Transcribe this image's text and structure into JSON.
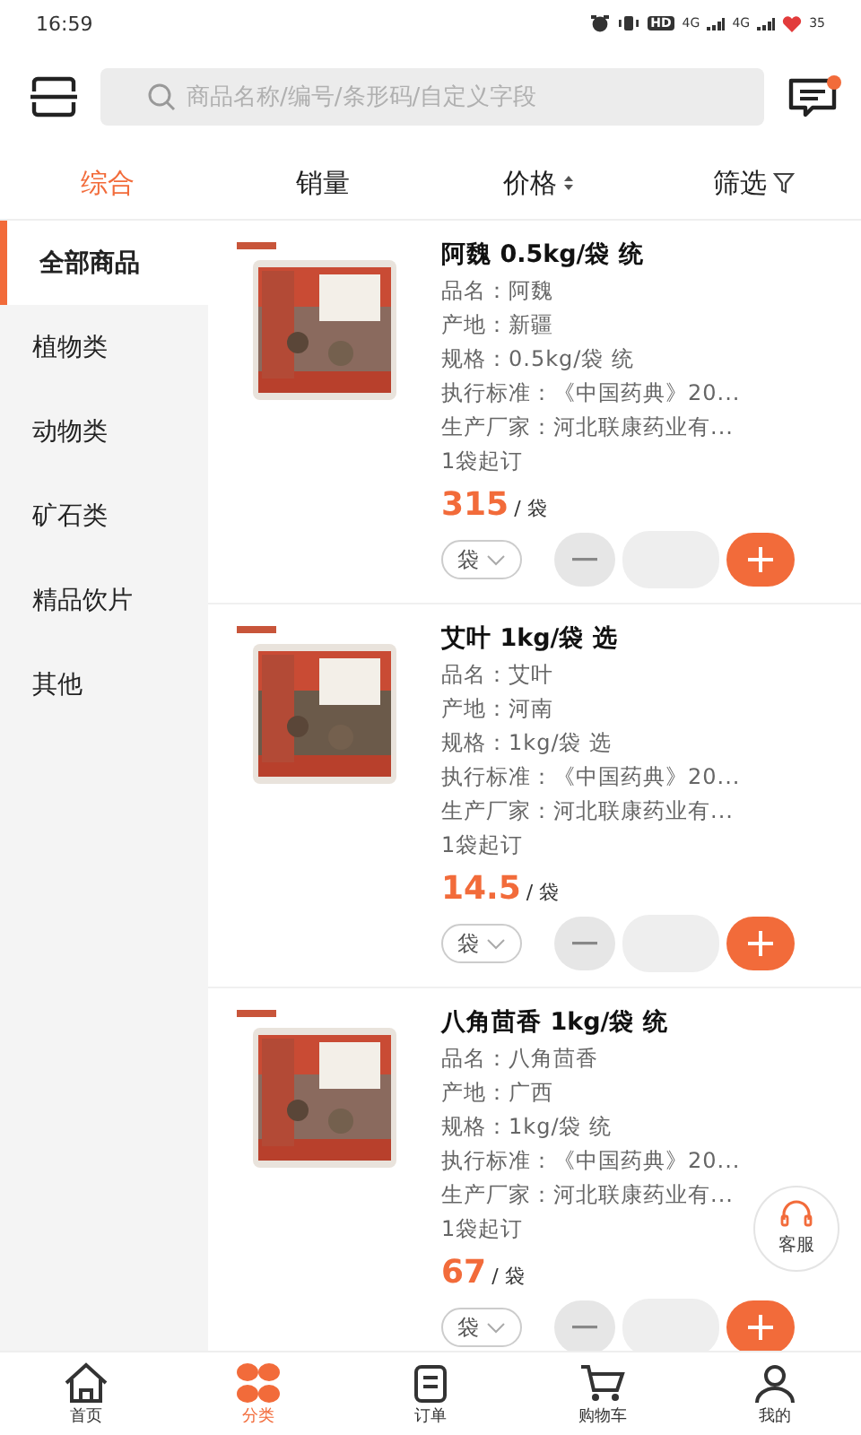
{
  "status_bar": {
    "time": "16:59",
    "hd": "HD",
    "networks": [
      "4G",
      "4G"
    ],
    "battery": "35"
  },
  "header": {
    "search": {
      "placeholder": "商品名称/编号/条形码/自定义字段"
    },
    "message_unread": true
  },
  "sort_tabs": [
    {
      "label": "综合",
      "selected": true,
      "kind": "plain"
    },
    {
      "label": "销量",
      "selected": false,
      "kind": "plain"
    },
    {
      "label": "价格",
      "selected": false,
      "kind": "sort"
    },
    {
      "label": "筛选",
      "selected": false,
      "kind": "filter"
    }
  ],
  "sidebar": {
    "items": [
      {
        "label": "全部商品",
        "selected": true
      },
      {
        "label": "植物类",
        "selected": false
      },
      {
        "label": "动物类",
        "selected": false
      },
      {
        "label": "矿石类",
        "selected": false
      },
      {
        "label": "精品饮片",
        "selected": false
      },
      {
        "label": "其他",
        "selected": false
      }
    ]
  },
  "products": [
    {
      "title": "阿魏 0.5kg/袋 统",
      "details": [
        "品名：阿魏",
        "产地：新疆",
        "规格：0.5kg/袋 统",
        "执行标准：《中国药典》20...",
        "生产厂家：河北联康药业有..."
      ],
      "min_order": "1袋起订",
      "price": "315",
      "price_unit": "/ 袋",
      "unit_select": "袋"
    },
    {
      "title": "艾叶 1kg/袋 选",
      "details": [
        "品名：艾叶",
        "产地：河南",
        "规格：1kg/袋 选",
        "执行标准：《中国药典》20...",
        "生产厂家：河北联康药业有..."
      ],
      "min_order": "1袋起订",
      "price": "14.5",
      "price_unit": "/ 袋",
      "unit_select": "袋"
    },
    {
      "title": "八角茴香 1kg/袋 统",
      "details": [
        "品名：八角茴香",
        "产地：广西",
        "规格：1kg/袋 统",
        "执行标准：《中国药典》20...",
        "生产厂家：河北联康药业有..."
      ],
      "min_order": "1袋起订",
      "price": "67",
      "price_unit": "/ 袋",
      "unit_select": "袋"
    }
  ],
  "service_button": {
    "label": "客服"
  },
  "bottom_nav": [
    {
      "label": "首页",
      "selected": false,
      "kind": "home"
    },
    {
      "label": "分类",
      "selected": true,
      "kind": "category"
    },
    {
      "label": "订单",
      "selected": false,
      "kind": "order"
    },
    {
      "label": "购物车",
      "selected": false,
      "kind": "cart"
    },
    {
      "label": "我的",
      "selected": false,
      "kind": "user"
    }
  ]
}
